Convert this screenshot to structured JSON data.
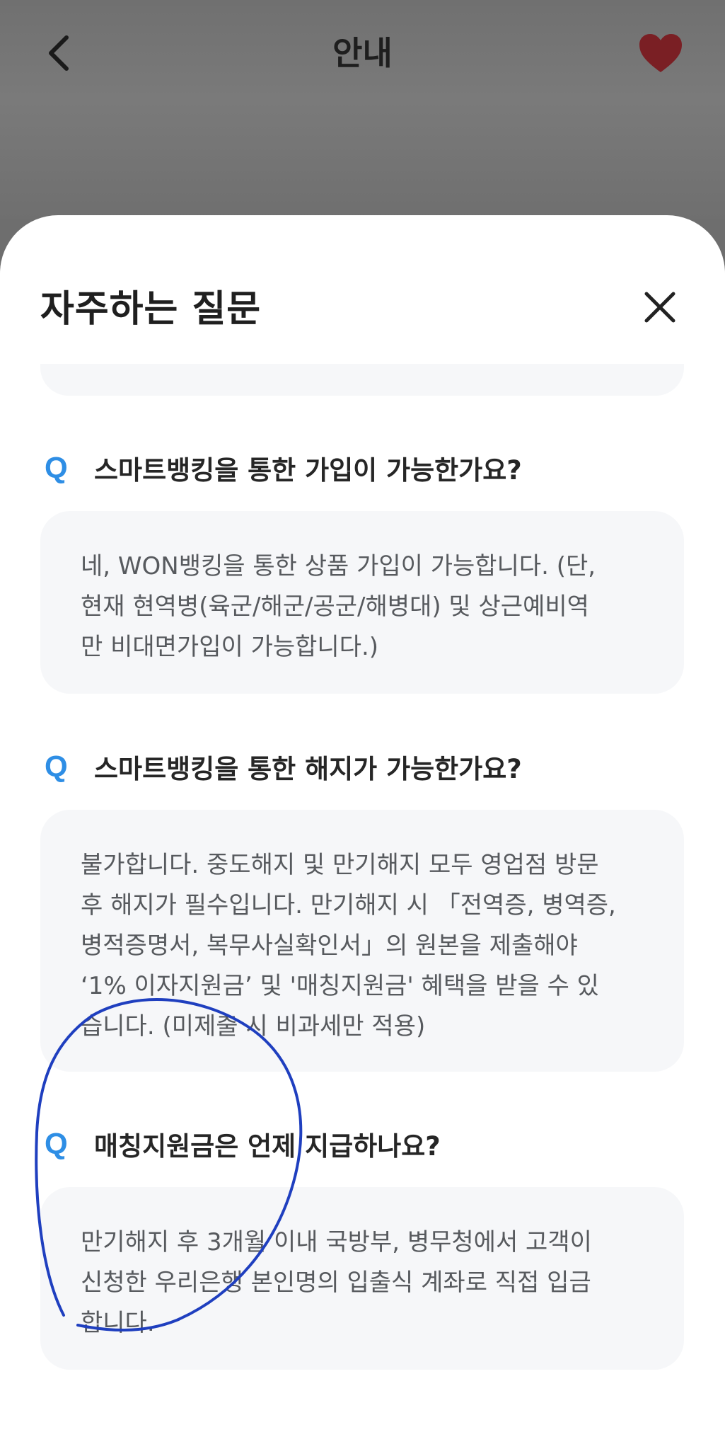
{
  "header": {
    "title": "안내",
    "back_icon": "chevron-left-icon",
    "favorite_icon": "heart-icon",
    "favorite_color": "#7a1f24"
  },
  "sheet": {
    "title": "자주하는 질문",
    "close_icon": "close-icon"
  },
  "faq": [
    {
      "q_mark": "Q",
      "question": "스마트뱅킹을 통한 가입이 가능한가요?",
      "answer": "네, WON뱅킹을 통한 상품 가입이 가능합니다. (단,\n현재 현역병(육군/해군/공군/해병대) 및 상근예비역\n만 비대면가입이 가능합니다.)"
    },
    {
      "q_mark": "Q",
      "question": "스마트뱅킹을 통한 해지가 가능한가요?",
      "answer": "불가합니다. 중도해지 및 만기해지 모두 영업점 방문\n후 해지가 필수입니다. 만기해지 시 「전역증, 병역증,\n병적증명서, 복무사실확인서」의 원본을 제출해야\n‘1% 이자지원금’ 및 '매칭지원금' 혜택을 받을 수 있\n습니다. (미제출 시 비과세만 적용)"
    },
    {
      "q_mark": "Q",
      "question": "매칭지원금은 언제 지급하나요?",
      "answer": "만기해지 후 3개월 이내 국방부, 병무청에서 고객이\n신청한 우리은행 본인명의 입출식 계좌로 직접 입금\n합니다."
    }
  ],
  "colors": {
    "accent_q": "#2e8ee5",
    "annotation_ink": "#1f3fbf",
    "card_bg": "#f6f7f9"
  }
}
